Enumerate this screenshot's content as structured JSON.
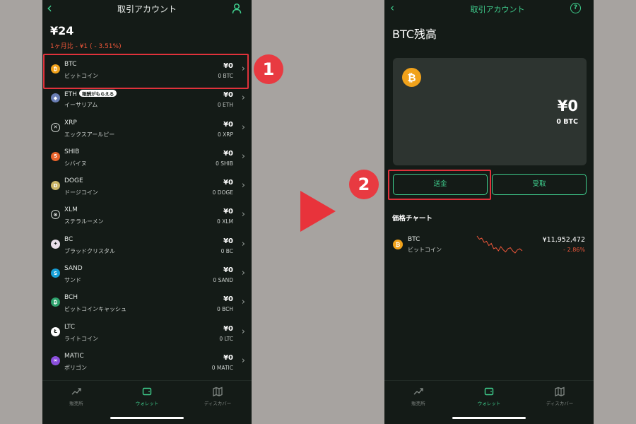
{
  "left": {
    "header_title": "取引アカウント",
    "total": "¥24",
    "change": "1ヶ月比 - ¥1 ( - 3.51%)",
    "badge_text": "報酬がもらえる",
    "assets": [
      {
        "sym": "BTC",
        "name": "ビットコイン",
        "yen": "¥0",
        "amount": "0 BTC",
        "color": "#f1a21b",
        "glyph": "₿"
      },
      {
        "sym": "ETH",
        "name": "イーサリアム",
        "yen": "¥0",
        "amount": "0 ETH",
        "color": "#6b7fb5",
        "glyph": "◆"
      },
      {
        "sym": "XRP",
        "name": "エックスアールピー",
        "yen": "¥0",
        "amount": "0 XRP",
        "color": "#141b17",
        "glyph": "✕"
      },
      {
        "sym": "SHIB",
        "name": "シバイヌ",
        "yen": "¥0",
        "amount": "0 SHIB",
        "color": "#e8632a",
        "glyph": "S"
      },
      {
        "sym": "DOGE",
        "name": "ドージコイン",
        "yen": "¥0",
        "amount": "0 DOGE",
        "color": "#c9b466",
        "glyph": "D"
      },
      {
        "sym": "XLM",
        "name": "ステラルーメン",
        "yen": "¥0",
        "amount": "0 XLM",
        "color": "#141b17",
        "glyph": "⊗"
      },
      {
        "sym": "BC",
        "name": "ブラッドクリスタル",
        "yen": "¥0",
        "amount": "0 BC",
        "color": "#e9dfe9",
        "glyph": "✦"
      },
      {
        "sym": "SAND",
        "name": "サンド",
        "yen": "¥0",
        "amount": "0 SAND",
        "color": "#17a0d8",
        "glyph": "S"
      },
      {
        "sym": "BCH",
        "name": "ビットコインキャッシュ",
        "yen": "¥0",
        "amount": "0 BCH",
        "color": "#2ea26d",
        "glyph": "₿"
      },
      {
        "sym": "LTC",
        "name": "ライトコイン",
        "yen": "¥0",
        "amount": "0 LTC",
        "color": "#ffffff",
        "glyph": "Ł"
      },
      {
        "sym": "MATIC",
        "name": "ポリゴン",
        "yen": "¥0",
        "amount": "0 MATIC",
        "color": "#8a4fdc",
        "glyph": "∞"
      }
    ],
    "tabs": [
      {
        "label": "販売所",
        "icon": "trend-icon"
      },
      {
        "label": "ウォレット",
        "icon": "wallet-icon"
      },
      {
        "label": "ディスカバー",
        "icon": "map-icon"
      }
    ]
  },
  "right": {
    "header_title": "取引アカウント",
    "help_glyph": "?",
    "page_title": "BTC残高",
    "card": {
      "glyph": "₿",
      "yen": "¥0",
      "amount": "0 BTC"
    },
    "send_label": "送金",
    "receive_label": "受取",
    "section_title": "価格チャート",
    "price_row": {
      "glyph": "₿",
      "sym": "BTC",
      "name": "ビットコイン",
      "price": "¥11,952,472",
      "change": "- 2.86%",
      "spark": [
        3,
        6,
        5,
        9,
        8,
        12,
        10,
        15,
        14,
        17,
        13,
        16,
        18,
        15,
        14,
        17,
        19,
        16,
        15,
        17
      ]
    },
    "tabs": [
      {
        "label": "販売所",
        "icon": "trend-icon"
      },
      {
        "label": "ウォレット",
        "icon": "wallet-icon"
      },
      {
        "label": "ディスカバー",
        "icon": "map-icon"
      }
    ]
  },
  "annotations": {
    "step1": "1",
    "step2": "2"
  },
  "colors": {
    "accent": "#3fcf8e",
    "negative": "#f0573a",
    "highlight": "#e0323b",
    "background": "#141b17"
  }
}
